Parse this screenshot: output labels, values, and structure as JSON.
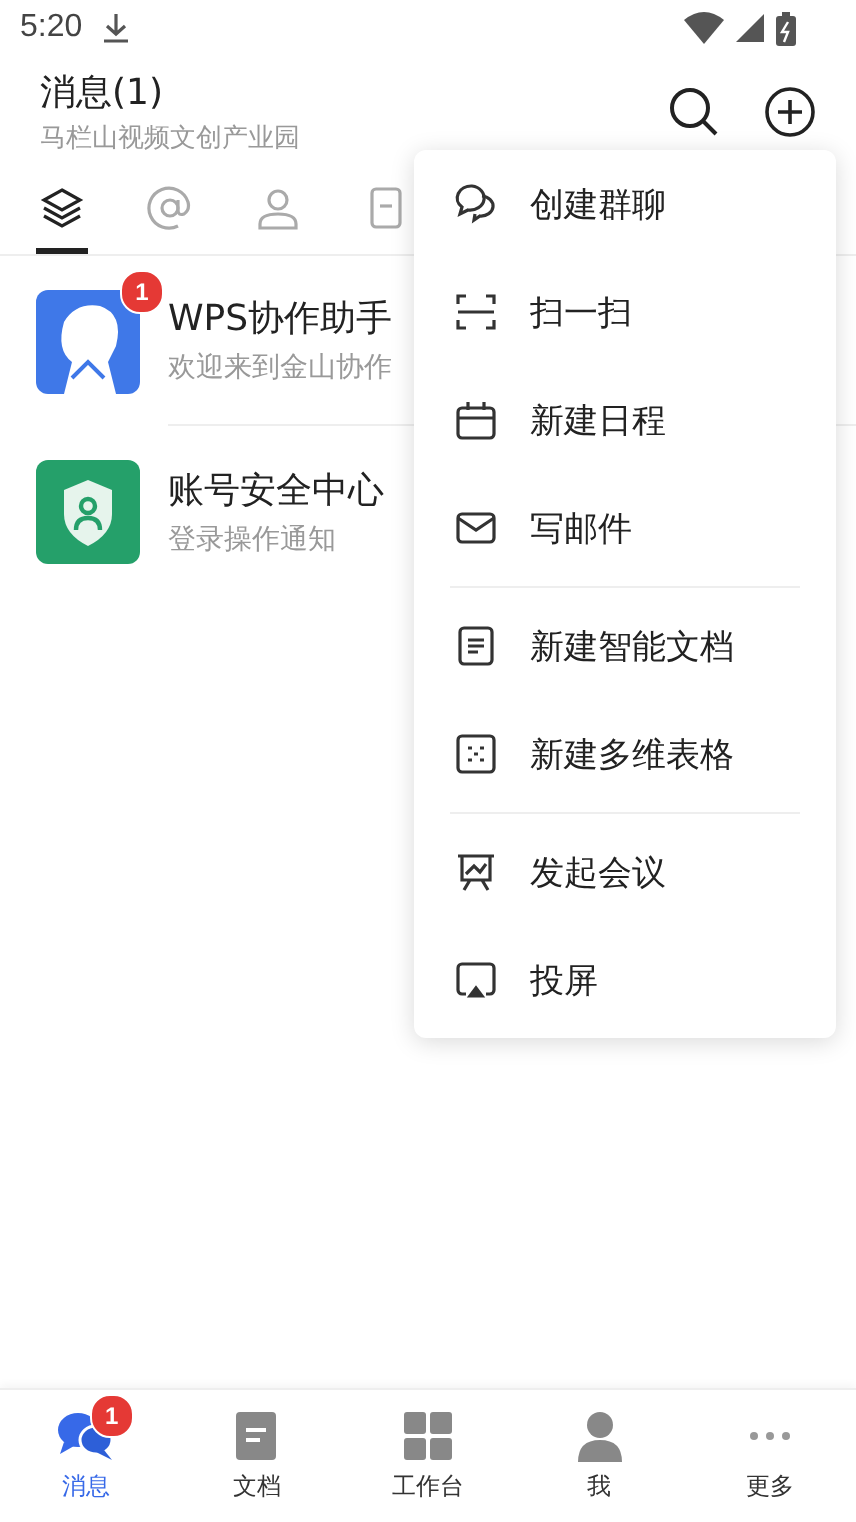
{
  "status_bar": {
    "time": "5:20"
  },
  "header": {
    "title": "消息(1)",
    "subtitle": "马栏山视频文创产业园"
  },
  "filter_tabs": [
    {
      "selected": true
    },
    {
      "selected": false
    },
    {
      "selected": false
    },
    {
      "selected": false
    }
  ],
  "conversations": [
    {
      "name": "WPS协作助手",
      "preview": "欢迎来到金山协作",
      "badge": "1"
    },
    {
      "name": "账号安全中心",
      "preview": "登录操作通知"
    }
  ],
  "menu": {
    "groups": [
      [
        {
          "label": "创建群聊"
        },
        {
          "label": "扫一扫"
        },
        {
          "label": "新建日程"
        },
        {
          "label": "写邮件"
        }
      ],
      [
        {
          "label": "新建智能文档"
        },
        {
          "label": "新建多维表格"
        }
      ],
      [
        {
          "label": "发起会议"
        },
        {
          "label": "投屏"
        }
      ]
    ]
  },
  "bottom_nav": [
    {
      "label": "消息",
      "selected": true,
      "badge": "1"
    },
    {
      "label": "文档",
      "selected": false
    },
    {
      "label": "工作台",
      "selected": false
    },
    {
      "label": "我",
      "selected": false
    },
    {
      "label": "更多",
      "selected": false
    }
  ]
}
